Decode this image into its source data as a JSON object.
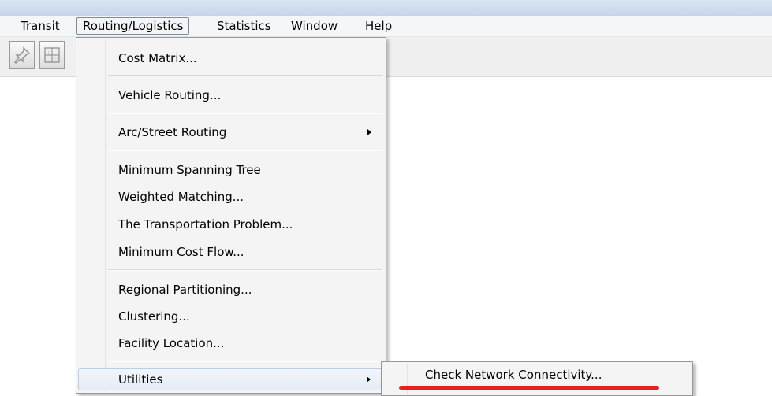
{
  "menubar": {
    "items": [
      {
        "label": "Transit"
      },
      {
        "label": "Routing/Logistics"
      },
      {
        "label": "Statistics"
      },
      {
        "label": "Window"
      },
      {
        "label": "Help"
      }
    ]
  },
  "toolbar": {
    "buttons": [
      {
        "icon": "pushpin-icon"
      },
      {
        "icon": "grid-icon"
      }
    ]
  },
  "routing_menu": {
    "items": [
      {
        "label": "Cost Matrix..."
      },
      {
        "label": "Vehicle Routing..."
      },
      {
        "label": "Arc/Street Routing",
        "has_submenu": true
      },
      {
        "label": "Minimum Spanning Tree"
      },
      {
        "label": "Weighted Matching..."
      },
      {
        "label": "The Transportation Problem..."
      },
      {
        "label": "Minimum Cost Flow..."
      },
      {
        "label": "Regional Partitioning..."
      },
      {
        "label": "Clustering..."
      },
      {
        "label": "Facility Location..."
      },
      {
        "label": "Utilities",
        "has_submenu": true,
        "highlighted": true
      }
    ]
  },
  "utilities_submenu": {
    "items": [
      {
        "label": "Check Network Connectivity..."
      }
    ]
  },
  "colors": {
    "highlight": "#e4ecf7",
    "annotation": "#e8201e"
  }
}
